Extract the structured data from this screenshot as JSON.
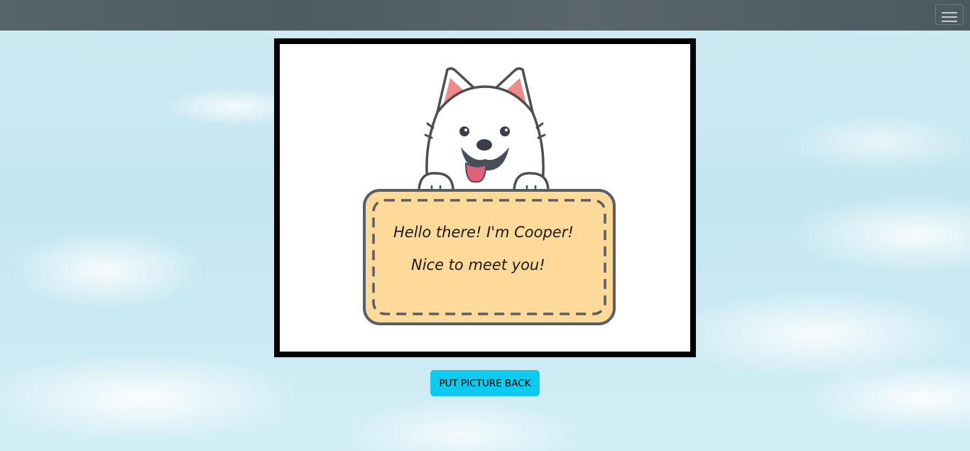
{
  "navbar": {
    "toggler_icon": "hamburger-menu-icon"
  },
  "picture": {
    "sign_line_1": "Hello there! I'm Cooper!",
    "sign_line_2": "Nice to meet you!"
  },
  "button": {
    "label": "PUT PICTURE BACK",
    "color": "#0dcaf0"
  }
}
